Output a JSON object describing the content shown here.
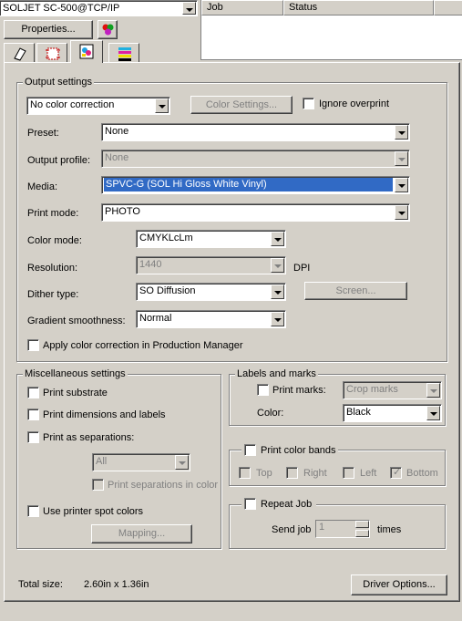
{
  "printer": {
    "name": "SOLJET SC-500@TCP/IP",
    "properties_label": "Properties..."
  },
  "job_list": {
    "col_job": "Job",
    "col_status": "Status"
  },
  "output": {
    "group_title": "Output settings",
    "color_correction": "No color correction",
    "color_settings_label": "Color Settings...",
    "ignore_overprint_label": "Ignore overprint",
    "preset_label": "Preset:",
    "preset_value": "None",
    "output_profile_label": "Output profile:",
    "output_profile_value": "None",
    "media_label": "Media:",
    "media_value": "SPVC-G (SOL Hi Gloss White Vinyl)",
    "print_mode_label": "Print mode:",
    "print_mode_value": "PHOTO",
    "color_mode_label": "Color mode:",
    "color_mode_value": "CMYKLcLm",
    "resolution_label": "Resolution:",
    "resolution_value": "1440",
    "resolution_unit": "DPI",
    "dither_label": "Dither type:",
    "dither_value": "SO Diffusion",
    "screen_label": "Screen...",
    "gradient_label": "Gradient smoothness:",
    "gradient_value": "Normal",
    "apply_cc_label": "Apply color correction in Production Manager"
  },
  "misc": {
    "group_title": "Miscellaneous settings",
    "print_substrate": "Print substrate",
    "print_dimensions": "Print dimensions and labels",
    "print_separations": "Print as separations:",
    "separations_value": "All",
    "print_separations_in_color": "Print separations in color",
    "use_spot_colors": "Use printer spot colors",
    "mapping_label": "Mapping..."
  },
  "labels_marks": {
    "group_title": "Labels and marks",
    "print_marks_label": "Print marks:",
    "print_marks_value": "Crop marks",
    "color_label": "Color:",
    "color_value": "Black"
  },
  "color_bands": {
    "title": "Print color bands",
    "top": "Top",
    "right": "Right",
    "left": "Left",
    "bottom": "Bottom"
  },
  "repeat": {
    "title": "Repeat Job",
    "send_job_label": "Send job",
    "send_job_value": "1",
    "times_label": "times"
  },
  "footer": {
    "total_size_label": "Total size:",
    "total_size_value": "2.60in x 1.36in",
    "driver_options_label": "Driver Options..."
  },
  "colors": {
    "selection": "#316ac5",
    "face": "#d4d0c8"
  }
}
